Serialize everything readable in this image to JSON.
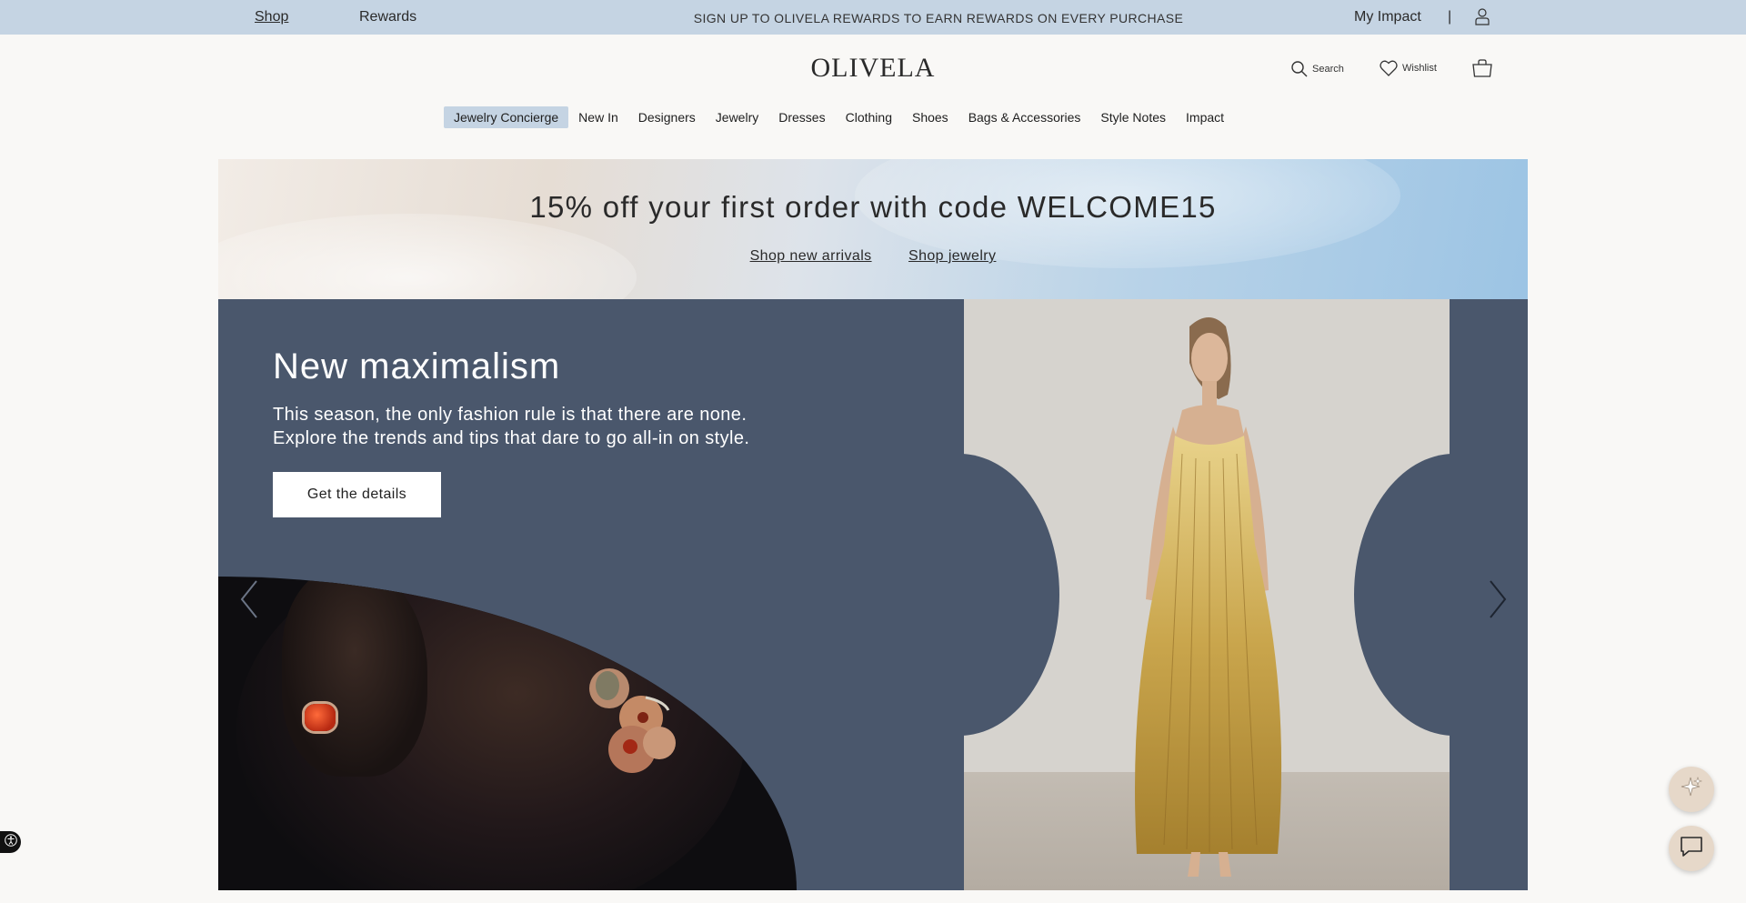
{
  "topbar": {
    "shop_label": "Shop",
    "rewards_label": "Rewards",
    "promo_text": "SIGN UP TO OLIVELA REWARDS TO EARN REWARDS ON EVERY PURCHASE",
    "impact_label": "My Impact",
    "separator": "|",
    "account_icon": "user-icon"
  },
  "header": {
    "logo": "OLIVELA",
    "search_label": "Search",
    "search_icon": "search-icon",
    "wishlist_label": "Wishlist",
    "wishlist_icon": "heart-icon",
    "bag_icon": "shopping-bag-icon"
  },
  "nav": {
    "items": [
      {
        "label": "Jewelry Concierge",
        "active": true
      },
      {
        "label": "New In"
      },
      {
        "label": "Designers"
      },
      {
        "label": "Jewelry"
      },
      {
        "label": "Dresses"
      },
      {
        "label": "Clothing"
      },
      {
        "label": "Shoes"
      },
      {
        "label": "Bags & Accessories"
      },
      {
        "label": "Style Notes"
      },
      {
        "label": "Impact"
      }
    ]
  },
  "banner": {
    "headline": "15% off your first order with code WELCOME15",
    "link_new_arrivals": "Shop new arrivals",
    "link_jewelry": "Shop jewelry"
  },
  "hero": {
    "title": "New maximalism",
    "subtitle_line1": "This season, the only fashion rule is that there are none.",
    "subtitle_line2": "Explore the trends and tips that dare to go all-in on style.",
    "cta_label": "Get the details",
    "prev_icon": "chevron-left-icon",
    "next_icon": "chevron-right-icon"
  },
  "floating": {
    "ai_icon": "sparkle-icon",
    "chat_icon": "chat-bubble-icon",
    "accessibility_icon": "accessibility-icon"
  },
  "colors": {
    "topbar_bg": "#c5d4e3",
    "hero_bg": "#4a576c",
    "page_bg": "#f9f8f6",
    "fab_bg": "#e6d8c9"
  }
}
